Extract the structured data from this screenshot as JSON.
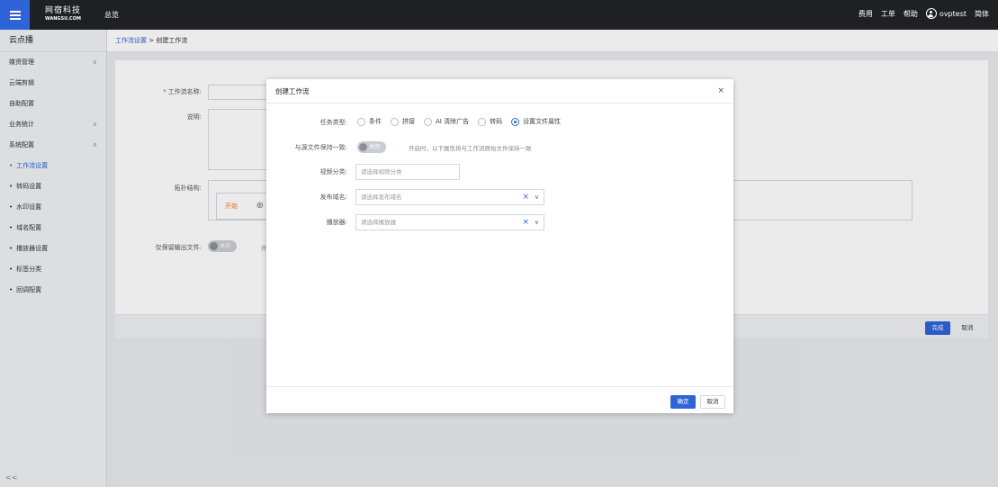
{
  "topbar": {
    "logo_cn": "网宿科技",
    "logo_en": "WANGSU.COM",
    "overview": "总览",
    "menu_fee": "费用",
    "menu_ticket": "工单",
    "menu_help": "帮助",
    "username": "ovptest",
    "language": "简体"
  },
  "sidebar": {
    "title": "云点播",
    "items": [
      {
        "label": "媒资管理",
        "chevron": "∨"
      },
      {
        "label": "云端剪辑"
      },
      {
        "label": "自助配置"
      },
      {
        "label": "业务统计",
        "chevron": "∨"
      },
      {
        "label": "系统配置",
        "chevron": "∧"
      }
    ],
    "sub_items": [
      {
        "label": "工作流设置"
      },
      {
        "label": "转码设置"
      },
      {
        "label": "水印设置"
      },
      {
        "label": "域名配置"
      },
      {
        "label": "播放器设置"
      },
      {
        "label": "标签分类"
      },
      {
        "label": "回调配置"
      }
    ],
    "collapse": "<<"
  },
  "breadcrumb": {
    "parent": "工作流设置",
    "separator": ">",
    "current": "创建工作流"
  },
  "form": {
    "name_label": "工作流名称:",
    "desc_label": "说明:",
    "topology_label": "拓扑结构:",
    "start_node": "开始",
    "start_plus": "⊕",
    "keep_output_label": "仅保留输出文件:",
    "keep_output_toggle": "关闭",
    "keep_output_hint": "开",
    "finish_button": "完成",
    "cancel_button": "取消"
  },
  "modal": {
    "title": "创建工作流",
    "close": "×",
    "task_type_label": "任务类型:",
    "task_types": [
      {
        "label": "条件",
        "selected": false
      },
      {
        "label": "拼接",
        "selected": false
      },
      {
        "label": "AI 清除广告",
        "selected": false
      },
      {
        "label": "转码",
        "selected": false
      },
      {
        "label": "设置文件属性",
        "selected": true
      }
    ],
    "source_consistent_label": "与源文件保持一致:",
    "source_consistent_toggle": "关闭",
    "source_consistent_hint": "开启时，以下属性将与工作流原始文件保持一致",
    "category_label": "视频分类:",
    "category_placeholder": "请选择视频分类",
    "domain_label": "发布域名:",
    "domain_placeholder": "请选择发布域名",
    "player_label": "播放器:",
    "player_placeholder": "请选择播放器",
    "clear_icon": "×",
    "dropdown_icon": "∨",
    "confirm_button": "确定",
    "cancel_button": "取消"
  },
  "colors": {
    "primary": "#2f63d8",
    "topbar": "#1f2024",
    "start_node": "#f27a1a"
  }
}
